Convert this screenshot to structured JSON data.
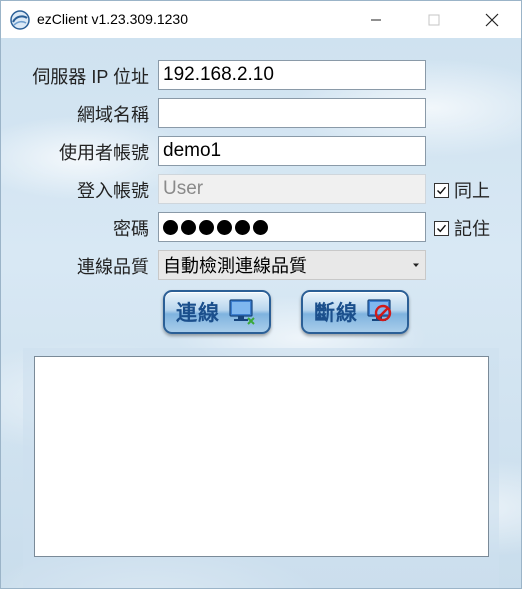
{
  "window": {
    "title": "ezClient v1.23.309.1230"
  },
  "form": {
    "server_ip": {
      "label": "伺服器 IP 位址",
      "value": "192.168.2.10"
    },
    "domain": {
      "label": "網域名稱",
      "value": ""
    },
    "username": {
      "label": "使用者帳號",
      "value": "demo1"
    },
    "login_account": {
      "label": "登入帳號",
      "placeholder": "User",
      "sync_label": "同上",
      "sync_checked": true
    },
    "password": {
      "label": "密碼",
      "masked_length": 6,
      "remember_label": "記住",
      "remember_checked": true
    },
    "quality": {
      "label": "連線品質",
      "selected": "自動檢測連線品質"
    }
  },
  "buttons": {
    "connect": "連線",
    "disconnect": "斷線"
  },
  "log": {
    "text": ""
  },
  "icons": {
    "app": "ezclient-logo-icon",
    "minimize": "minimize-icon",
    "maximize": "maximize-icon",
    "close": "close-icon",
    "connect": "monitor-connect-icon",
    "disconnect": "monitor-disconnect-icon",
    "dropdown": "chevron-down-icon"
  }
}
